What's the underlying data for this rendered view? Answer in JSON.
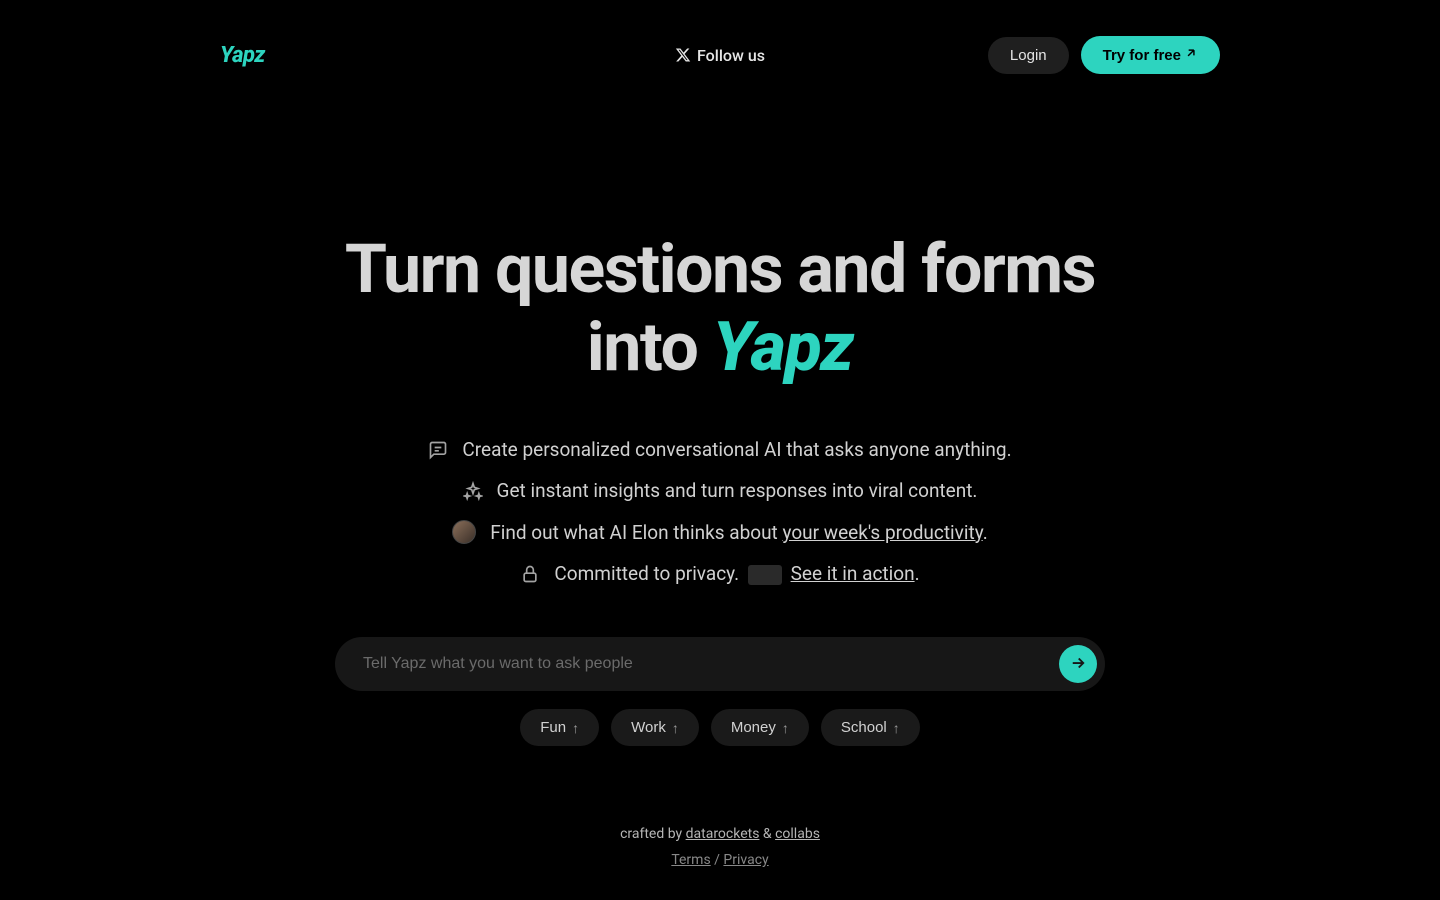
{
  "header": {
    "logo": "Yapz",
    "follow_label": "Follow us",
    "login_label": "Login",
    "cta_label": "Try for free"
  },
  "hero": {
    "title_line1": "Turn questions and forms",
    "title_line2_prefix": "into ",
    "title_line2_brand": "Yapz"
  },
  "features": {
    "f1": "Create personalized conversational AI that asks anyone anything.",
    "f2": "Get instant insights and turn responses into viral content.",
    "f3_prefix": "Find out what AI Elon thinks about ",
    "f3_link": "your week's productivity",
    "f3_suffix": ".",
    "f4_prefix": "Committed to privacy. ",
    "f4_link": "See it in action",
    "f4_suffix": "."
  },
  "prompt": {
    "placeholder": "Tell Yapz what you want to ask people"
  },
  "chips": {
    "c1": "Fun",
    "c2": "Work",
    "c3": "Money",
    "c4": "School"
  },
  "footer": {
    "crafted_prefix": "crafted by ",
    "crafted_link1": "datarockets",
    "crafted_mid": " & ",
    "crafted_link2": "collabs",
    "terms": "Terms",
    "sep": " / ",
    "privacy": "Privacy"
  }
}
